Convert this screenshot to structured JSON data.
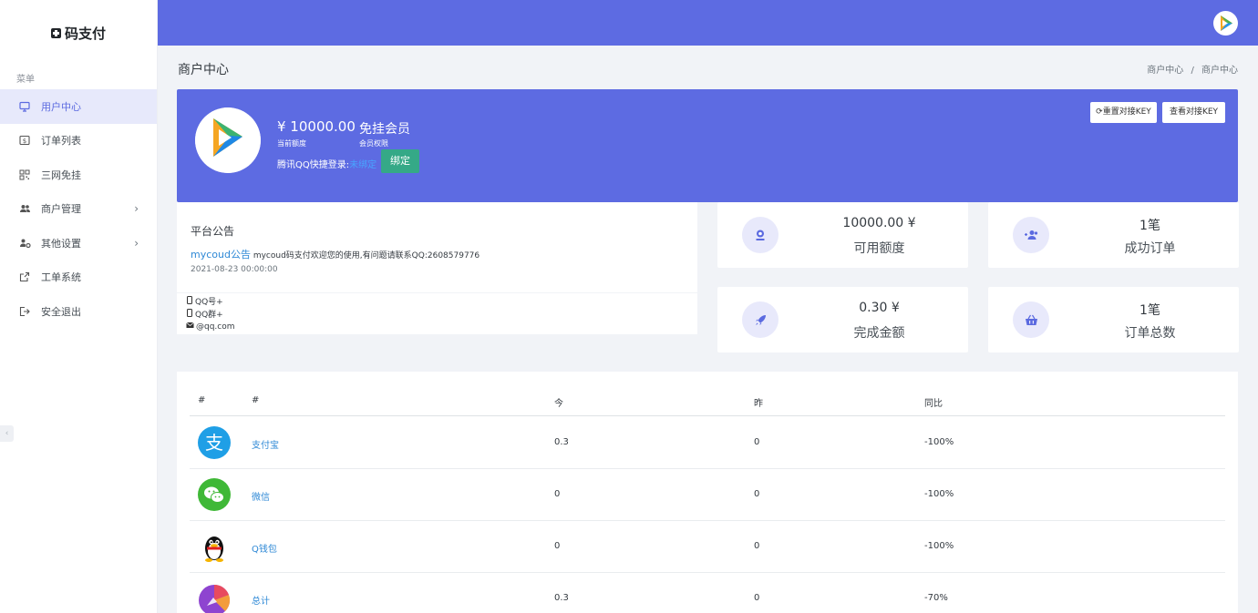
{
  "app": {
    "brand": "码支付"
  },
  "sidebar": {
    "menu_title": "菜单",
    "items": [
      {
        "label": "用户中心",
        "icon": "monitor-icon",
        "active": true
      },
      {
        "label": "订单列表",
        "icon": "dollar-icon"
      },
      {
        "label": "三网免挂",
        "icon": "qrcode-icon"
      },
      {
        "label": "商户管理",
        "icon": "users-icon",
        "arrow": "›"
      },
      {
        "label": "其他设置",
        "icon": "user-cog-icon",
        "arrow": "›"
      },
      {
        "label": "工单系统",
        "icon": "external-link-icon"
      },
      {
        "label": "安全退出",
        "icon": "logout-icon"
      }
    ],
    "toggle": "‹"
  },
  "page": {
    "title": "商户中心",
    "breadcrumb": [
      "商户中心",
      "/",
      "商户中心"
    ]
  },
  "profile": {
    "balance": "¥ 10000.00",
    "balance_label": "当前额度",
    "member": "免挂会员",
    "member_label": "会员权限",
    "qq_login_label": "腾讯QQ快捷登录:",
    "qq_login_status": "未绑定",
    "bind_button": "绑定",
    "reset_key_button": "重置对接KEY",
    "view_key_button": "查看对接KEY",
    "accent_color": "#5d6be2"
  },
  "notice": {
    "title": "平台公告",
    "link": "mycoud公告",
    "text": "mycoud码支付欢迎您的使用,有问题请联系QQ:2608579776",
    "date": "2021-08-23 00:00:00"
  },
  "contact": {
    "qq": "QQ号+",
    "qq_group": "QQ群+",
    "email": "@qq.com"
  },
  "stats": [
    {
      "value": "10000.00 ¥",
      "label": "可用额度",
      "icon": "wallet-icon"
    },
    {
      "value": "1笔",
      "label": "成功订单",
      "icon": "user-plus-icon"
    },
    {
      "value": "0.30 ¥",
      "label": "完成金额",
      "icon": "rocket-icon"
    },
    {
      "value": "1笔",
      "label": "订单总数",
      "icon": "basket-icon"
    }
  ],
  "table": {
    "headers": [
      "#",
      "#",
      "今",
      "昨",
      "同比"
    ],
    "rows": [
      {
        "name": "支付宝",
        "today": "0.3",
        "yesterday": "0",
        "change": "-100%",
        "icon": "alipay-icon"
      },
      {
        "name": "微信",
        "today": "0",
        "yesterday": "0",
        "change": "-100%",
        "icon": "wechat-icon"
      },
      {
        "name": "Q钱包",
        "today": "0",
        "yesterday": "0",
        "change": "-100%",
        "icon": "qq-wallet-icon"
      },
      {
        "name": "总计",
        "today": "0.3",
        "yesterday": "0",
        "change": "-70%",
        "icon": "total-icon"
      }
    ]
  }
}
